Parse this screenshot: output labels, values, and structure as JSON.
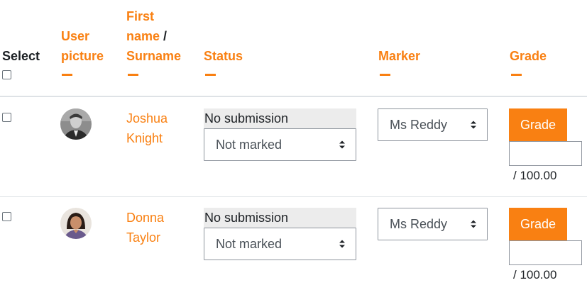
{
  "header": {
    "select": "Select",
    "user_picture_line1": "User",
    "user_picture_line2": "picture",
    "first_name": "First",
    "first_name_line2": "name",
    "name_slash": "/",
    "surname": "Surname",
    "status": "Status",
    "marker": "Marker",
    "grade": "Grade"
  },
  "rows": [
    {
      "first_name": "Joshua",
      "surname": "Knight",
      "status": "No submission",
      "marking_state": "Not marked",
      "marker": "Ms Reddy",
      "grade_button": "Grade",
      "grade_value": "",
      "out_of": "/ 100.00",
      "avatar_icon": "user-avatar-male"
    },
    {
      "first_name": "Donna",
      "surname": "Taylor",
      "status": "No submission",
      "marking_state": "Not marked",
      "marker": "Ms Reddy",
      "grade_button": "Grade",
      "grade_value": "",
      "out_of": "/ 100.00",
      "avatar_icon": "user-avatar-female"
    }
  ],
  "colors": {
    "accent": "#f98012",
    "status_bg": "#ececec",
    "text": "#1d2125"
  }
}
